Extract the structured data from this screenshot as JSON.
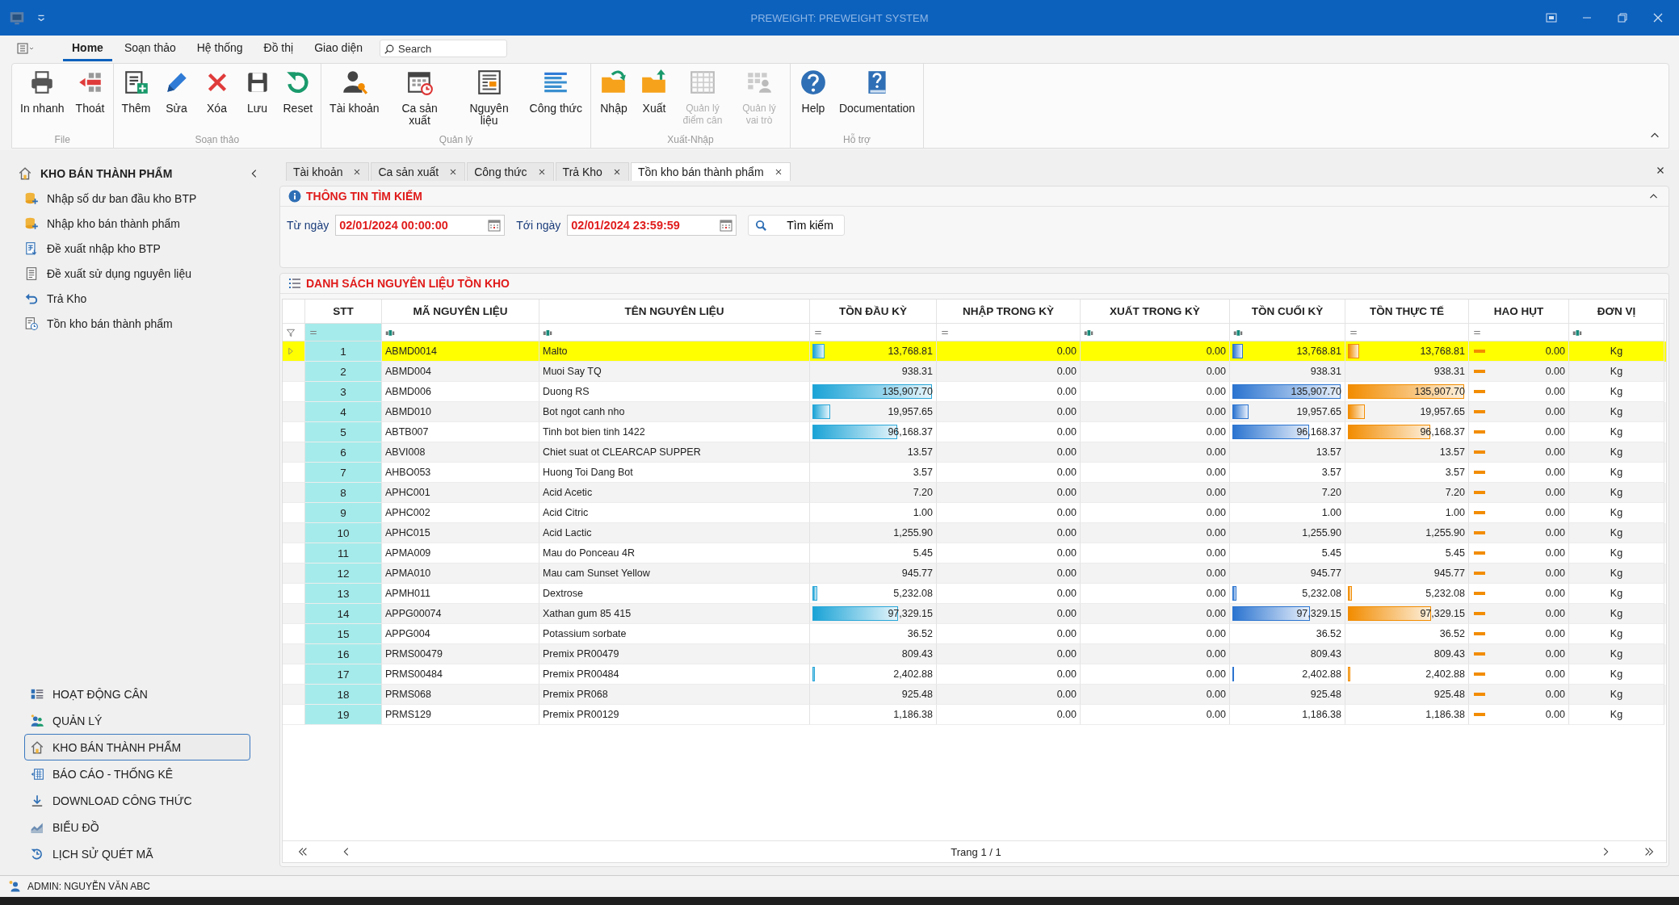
{
  "window": {
    "title": "PREWEIGHT: PREWEIGHT SYSTEM"
  },
  "menu": {
    "tabs": [
      {
        "label": "Home",
        "selected": true
      },
      {
        "label": "Soạn thảo",
        "selected": false
      },
      {
        "label": "Hệ thống",
        "selected": false
      },
      {
        "label": "Đồ thị",
        "selected": false
      },
      {
        "label": "Giao diện",
        "selected": false
      }
    ],
    "search": {
      "placeholder": "Search"
    }
  },
  "ribbon": [
    {
      "label": "File",
      "buttons": [
        {
          "label": "In nhanh",
          "disabled": false
        },
        {
          "label": "Thoát",
          "disabled": false
        }
      ]
    },
    {
      "label": "Soạn thảo",
      "buttons": [
        {
          "label": "Thêm",
          "disabled": false
        },
        {
          "label": "Sửa",
          "disabled": false
        },
        {
          "label": "Xóa",
          "disabled": false
        },
        {
          "label": "Lưu",
          "disabled": false
        },
        {
          "label": "Reset",
          "disabled": false
        }
      ]
    },
    {
      "label": "Quản lý",
      "buttons": [
        {
          "label": "Tài khoản",
          "disabled": false
        },
        {
          "label": "Ca sản xuất",
          "disabled": false
        },
        {
          "label": "Nguyên liệu",
          "disabled": false
        },
        {
          "label": "Công thức",
          "disabled": false
        }
      ]
    },
    {
      "label": "Xuất-Nhập",
      "buttons": [
        {
          "label": "Nhập",
          "disabled": false
        },
        {
          "label": "Xuất",
          "disabled": false
        },
        {
          "label": "Quản lý điểm cân",
          "disabled": true
        },
        {
          "label": "Quản lý vai trò",
          "disabled": true
        }
      ]
    },
    {
      "label": "Hỗ trợ",
      "buttons": [
        {
          "label": "Help",
          "disabled": false
        },
        {
          "label": "Documentation",
          "disabled": false
        }
      ]
    }
  ],
  "sidebar": {
    "title": "KHO BÁN THÀNH PHẨM",
    "items": [
      {
        "label": "Nhập số dư ban đầu kho BTP"
      },
      {
        "label": "Nhập kho bán thành phẩm"
      },
      {
        "label": "Đề xuất nhập kho BTP"
      },
      {
        "label": "Đề xuất sử dụng nguyên liệu"
      },
      {
        "label": "Trả Kho"
      },
      {
        "label": "Tồn kho bán thành phẩm"
      }
    ],
    "groups": [
      {
        "label": "HOẠT ĐỘNG CÂN",
        "selected": false
      },
      {
        "label": "QUẢN LÝ",
        "selected": false
      },
      {
        "label": "KHO BÁN THÀNH PHẨM",
        "selected": true
      },
      {
        "label": "BÁO CÁO - THỐNG KÊ",
        "selected": false
      },
      {
        "label": "DOWNLOAD CÔNG THỨC",
        "selected": false
      },
      {
        "label": "BIỂU ĐỒ",
        "selected": false
      },
      {
        "label": "LỊCH SỬ QUÉT MÃ",
        "selected": false
      }
    ]
  },
  "doc_tabs": [
    {
      "label": "Tài khoản",
      "selected": false
    },
    {
      "label": "Ca sản xuất",
      "selected": false
    },
    {
      "label": "Công thức",
      "selected": false
    },
    {
      "label": "Trả Kho",
      "selected": false
    },
    {
      "label": "Tồn kho bán thành phẩm",
      "selected": true
    }
  ],
  "search_panel": {
    "title": "THÔNG TIN TÌM KIẾM",
    "from_label": "Từ ngày",
    "from_value": "02/01/2024 00:00:00",
    "to_label": "Tới ngày",
    "to_value": "02/01/2024 23:59:59",
    "button": "Tìm kiếm"
  },
  "grid": {
    "title": "DANH SÁCH NGUYÊN LIỆU TỒN KHO",
    "columns": [
      {
        "label": "STT",
        "kind": "index"
      },
      {
        "label": "MÃ NGUYÊN LIỆU",
        "kind": "text"
      },
      {
        "label": "TÊN NGUYÊN LIỆU",
        "kind": "text"
      },
      {
        "label": "TỒN ĐẦU KỲ",
        "kind": "bar_cyan"
      },
      {
        "label": "NHẬP TRONG KỲ",
        "kind": "number"
      },
      {
        "label": "XUẤT TRONG KỲ",
        "kind": "number"
      },
      {
        "label": "TỒN CUỐI KỲ",
        "kind": "bar_blue"
      },
      {
        "label": "TỒN THỰC TẾ",
        "kind": "bar_orange"
      },
      {
        "label": "HAO HỤT",
        "kind": "loss"
      },
      {
        "label": "ĐƠN VỊ",
        "kind": "unit"
      }
    ],
    "rows": [
      {
        "selected": true,
        "level": 0.1,
        "cells": [
          "1",
          "ABMD0014",
          "Malto",
          "13,768.81",
          "0.00",
          "0.00",
          "13,768.81",
          "13,768.81",
          "0.00",
          "Kg"
        ]
      },
      {
        "selected": false,
        "cells": [
          "2",
          "ABMD004",
          "Muoi Say TQ",
          "938.31",
          "0.00",
          "0.00",
          "938.31",
          "938.31",
          "0.00",
          "Kg"
        ]
      },
      {
        "selected": false,
        "level": 1,
        "cells": [
          "3",
          "ABMD006",
          "Duong RS",
          "135,907.70",
          "0.00",
          "0.00",
          "135,907.70",
          "135,907.70",
          "0.00",
          "Kg"
        ]
      },
      {
        "selected": false,
        "level": 0.147,
        "cells": [
          "4",
          "ABMD010",
          "Bot ngot canh nho",
          "19,957.65",
          "0.00",
          "0.00",
          "19,957.65",
          "19,957.65",
          "0.00",
          "Kg"
        ]
      },
      {
        "selected": false,
        "level": 0.708,
        "cells": [
          "5",
          "ABTB007",
          "Tinh bot bien tinh 1422",
          "96,168.37",
          "0.00",
          "0.00",
          "96,168.37",
          "96,168.37",
          "0.00",
          "Kg"
        ]
      },
      {
        "selected": false,
        "cells": [
          "6",
          "ABVI008",
          "Chiet suat ot CLEARCAP SUPPER",
          "13.57",
          "0.00",
          "0.00",
          "13.57",
          "13.57",
          "0.00",
          "Kg"
        ]
      },
      {
        "selected": false,
        "cells": [
          "7",
          "AHBO053",
          "Huong Toi Dang Bot",
          "3.57",
          "0.00",
          "0.00",
          "3.57",
          "3.57",
          "0.00",
          "Kg"
        ]
      },
      {
        "selected": false,
        "cells": [
          "8",
          "APHC001",
          "Acid Acetic",
          "7.20",
          "0.00",
          "0.00",
          "7.20",
          "7.20",
          "0.00",
          "Kg"
        ]
      },
      {
        "selected": false,
        "cells": [
          "9",
          "APHC002",
          "Acid Citric",
          "1.00",
          "0.00",
          "0.00",
          "1.00",
          "1.00",
          "0.00",
          "Kg"
        ]
      },
      {
        "selected": false,
        "cells": [
          "10",
          "APHC015",
          "Acid Lactic",
          "1,255.90",
          "0.00",
          "0.00",
          "1,255.90",
          "1,255.90",
          "0.00",
          "Kg"
        ]
      },
      {
        "selected": false,
        "cells": [
          "11",
          "APMA009",
          "Mau do Ponceau 4R",
          "5.45",
          "0.00",
          "0.00",
          "5.45",
          "5.45",
          "0.00",
          "Kg"
        ]
      },
      {
        "selected": false,
        "cells": [
          "12",
          "APMA010",
          "Mau cam Sunset Yellow",
          "945.77",
          "0.00",
          "0.00",
          "945.77",
          "945.77",
          "0.00",
          "Kg"
        ]
      },
      {
        "selected": false,
        "level": 0.038,
        "cells": [
          "13",
          "APMH011",
          "Dextrose",
          "5,232.08",
          "0.00",
          "0.00",
          "5,232.08",
          "5,232.08",
          "0.00",
          "Kg"
        ]
      },
      {
        "selected": false,
        "level": 0.716,
        "cells": [
          "14",
          "APPG00074",
          "Xathan gum 85 415",
          "97,329.15",
          "0.00",
          "0.00",
          "97,329.15",
          "97,329.15",
          "0.00",
          "Kg"
        ]
      },
      {
        "selected": false,
        "cells": [
          "15",
          "APPG004",
          "Potassium sorbate",
          "36.52",
          "0.00",
          "0.00",
          "36.52",
          "36.52",
          "0.00",
          "Kg"
        ]
      },
      {
        "selected": false,
        "cells": [
          "16",
          "PRMS00479",
          "Premix PR00479",
          "809.43",
          "0.00",
          "0.00",
          "809.43",
          "809.43",
          "0.00",
          "Kg"
        ]
      },
      {
        "selected": false,
        "level": 0.018,
        "cells": [
          "17",
          "PRMS00484",
          "Premix PR00484",
          "2,402.88",
          "0.00",
          "0.00",
          "2,402.88",
          "2,402.88",
          "0.00",
          "Kg"
        ]
      },
      {
        "selected": false,
        "cells": [
          "18",
          "PRMS068",
          "Premix PR068",
          "925.48",
          "0.00",
          "0.00",
          "925.48",
          "925.48",
          "0.00",
          "Kg"
        ]
      },
      {
        "selected": false,
        "cells": [
          "19",
          "PRMS129",
          "Premix PR00129",
          "1,186.38",
          "0.00",
          "0.00",
          "1,186.38",
          "1,186.38",
          "0.00",
          "Kg"
        ]
      }
    ],
    "pager": "Trang 1 / 1"
  },
  "status_bar": {
    "user": "ADMIN: NGUYỄN VĂN ABC"
  }
}
